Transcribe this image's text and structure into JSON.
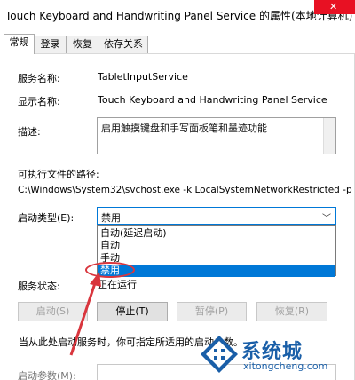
{
  "window": {
    "title": "Touch Keyboard and Handwriting Panel Service 的属性(本地计算机)"
  },
  "tabs": [
    {
      "label": "常规",
      "active": true
    },
    {
      "label": "登录",
      "active": false
    },
    {
      "label": "恢复",
      "active": false
    },
    {
      "label": "依存关系",
      "active": false
    }
  ],
  "general": {
    "service_name_label": "服务名称:",
    "service_name_value": "TabletInputService",
    "display_name_label": "显示名称:",
    "display_name_value": "Touch Keyboard and Handwriting Panel Service",
    "description_label": "描述:",
    "description_value": "启用触摸键盘和手写面板笔和墨迹功能",
    "exe_path_label": "可执行文件的路径:",
    "exe_path_value": "C:\\Windows\\System32\\svchost.exe -k LocalSystemNetworkRestricted -p",
    "startup_type_label": "启动类型(E):",
    "startup_type_value": "禁用",
    "startup_options": [
      {
        "label": "自动(延迟启动)",
        "selected": false
      },
      {
        "label": "自动",
        "selected": false
      },
      {
        "label": "手动",
        "selected": false
      },
      {
        "label": "禁用",
        "selected": true
      }
    ],
    "service_status_label": "服务状态:",
    "service_status_value": "正在运行",
    "buttons": {
      "start": "启动(S)",
      "stop": "停止(T)",
      "pause": "暂停(P)",
      "resume": "恢复(R)"
    },
    "note": "当从此处启动服务时，你可指定所适用的启动参数。",
    "start_params_label": "启动参数(M):"
  },
  "watermark": {
    "brand": "系统城",
    "site": "xitongcheng.com"
  },
  "colors": {
    "accent": "#0078d7",
    "annotation": "#d9363e",
    "brand": "#1a5fa8",
    "close": "#e81123"
  }
}
